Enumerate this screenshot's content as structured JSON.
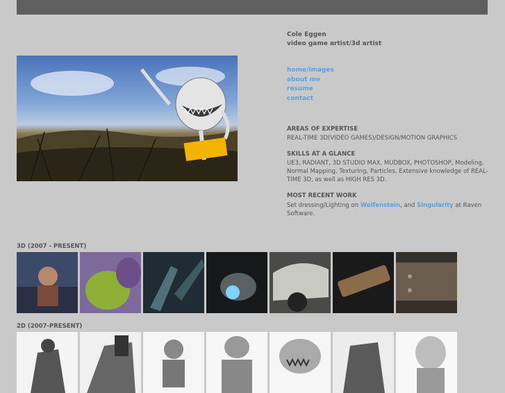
{
  "header": {
    "name": "Cole Eggen",
    "role": "video game artist/3d artist"
  },
  "nav": [
    {
      "label": "home/images"
    },
    {
      "label": "about me"
    },
    {
      "label": "resume"
    },
    {
      "label": "contact"
    }
  ],
  "expertise": {
    "heading": "AREAS OF EXPERTISE",
    "text": "REAL-TIME 3D(VIDEO GAMES)/DESIGN/MOTION GRAPHICS"
  },
  "skills": {
    "heading": "SKILLS AT A GLANCE",
    "text": "UE3, RADIANT, 3D STUDIO MAX, MUDBOX, PHOTOSHOP, Modeling, Normal Mapping, Texturing, Particles, Extensive knowledge of REAL-TIME 3D, as well as HIGH RES 3D."
  },
  "recent": {
    "heading": "MOST RECENT WORK",
    "prefix": "Set dressing/Lighting on ",
    "link1": "Wolfenstein",
    "mid": ", and ",
    "link2": "Singularity",
    "suffix": " at Raven Software."
  },
  "gallery3d": {
    "heading": "3D (2007 - PRESENT)"
  },
  "gallery2d": {
    "heading": "2D (2007-PRESENT)"
  },
  "colors": {
    "link": "#5aa0e6",
    "text": "#555555",
    "background": "#c9c9c9",
    "topbar": "#5f5f5f"
  }
}
